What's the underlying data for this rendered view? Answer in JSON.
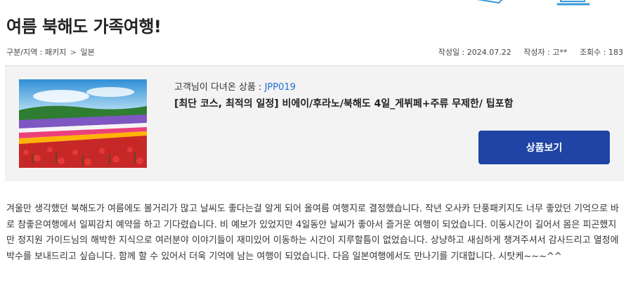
{
  "post": {
    "title": "여름 북해도 가족여행!",
    "breadcrumb": {
      "label": "구분/지역 : 패키지",
      "separator": ">",
      "region": "일본"
    },
    "meta": {
      "date": "작성일 : 2024.07.22",
      "author": "작성자 : 고**",
      "views": "조회수 : 183"
    }
  },
  "product": {
    "visitor_prefix": "고객님이 다녀온 상품 : ",
    "code": "JPP019",
    "name": "[최단 코스, 최적의 일정] 비에이/후라노/북해도 4일_게뷔페+주류 무제한/ 팁포함",
    "button_label": "상품보기",
    "image_icon": "flower-field-photo"
  },
  "review": {
    "text": "겨울만 생각했던 북해도가 여름에도 볼거리가 많고 날씨도 좋다는걸 알게 되어 올여름 여행지로 결정했습니다. 작년 오사카 단풍패키지도 너무 좋았던 기억으로 바로 참좋은여행에서 일찌감치 예약을 하고 기다렸습니다. 비 예보가 있었지만 4일동안 날씨가 좋아서 즐거운 여행이 되었습니다.  이동시간이 길어서 몸은 피곤했지만 정지원 가이드님의 해박한 지식으로 여러분야 이야기들이 재미있어 이동하는 시간이 지루할틈이 없었습니다. 상냥하고 새심하게 챙겨주셔서 감사드리고 열정에 박수를 보내드리고 싶습니다. 함께 할 수 있어서 더욱 기억에 남는 여행이 되었습니다. 다음 일본여행에서도 만나기를 기대합니다. 시탓케~~~^^"
  },
  "colors": {
    "accent": "#1f44a5",
    "product_code": "#1e6fd9",
    "box_background": "#f3f3f3",
    "deco_blue": "#3a9ad9"
  }
}
